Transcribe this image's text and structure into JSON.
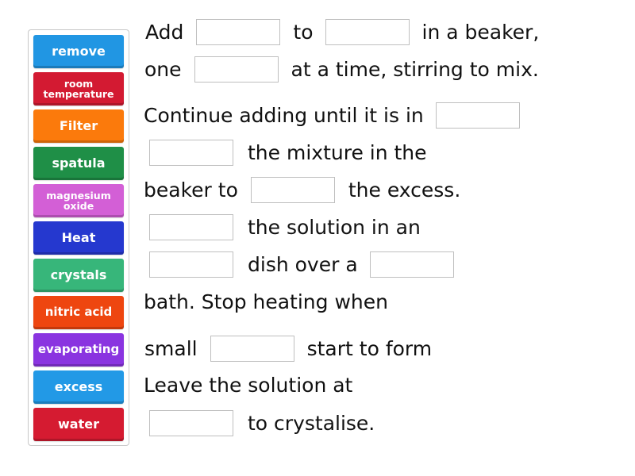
{
  "tiles": [
    {
      "label": "remove",
      "color": "#2196e3"
    },
    {
      "label": "room temperature",
      "color": "#d31a32"
    },
    {
      "label": "Filter",
      "color": "#fb7a0c"
    },
    {
      "label": "spatula",
      "color": "#1f8f47"
    },
    {
      "label": "magnesium oxide",
      "color": "#d35fd6"
    },
    {
      "label": "Heat",
      "color": "#2538cf"
    },
    {
      "label": "crystals",
      "color": "#37b67a"
    },
    {
      "label": "nitric acid",
      "color": "#ee4610"
    },
    {
      "label": "evaporating",
      "color": "#8a34e0"
    },
    {
      "label": "excess",
      "color": "#2299e6"
    },
    {
      "label": "water",
      "color": "#d51b31"
    }
  ],
  "text": {
    "l1_a": "Add",
    "l1_b": "to",
    "l1_c": "in a beaker,",
    "l2_a": "one",
    "l2_b": "at a time, stirring to mix.",
    "l3_a": "Continue adding until it is in",
    "l4_a": "the mixture in the",
    "l5_a": "beaker to",
    "l5_b": "the excess.",
    "l6_a": "the solution in an",
    "l7_a": "dish over a",
    "l8_a": "bath. Stop heating when",
    "l9_a": "small",
    "l9_b": "start to form",
    "l10_a": "Leave the solution at",
    "l11_a": "to crystalise."
  },
  "blanks": [
    "",
    "",
    "",
    "",
    "",
    "",
    "",
    "",
    "",
    "",
    ""
  ]
}
